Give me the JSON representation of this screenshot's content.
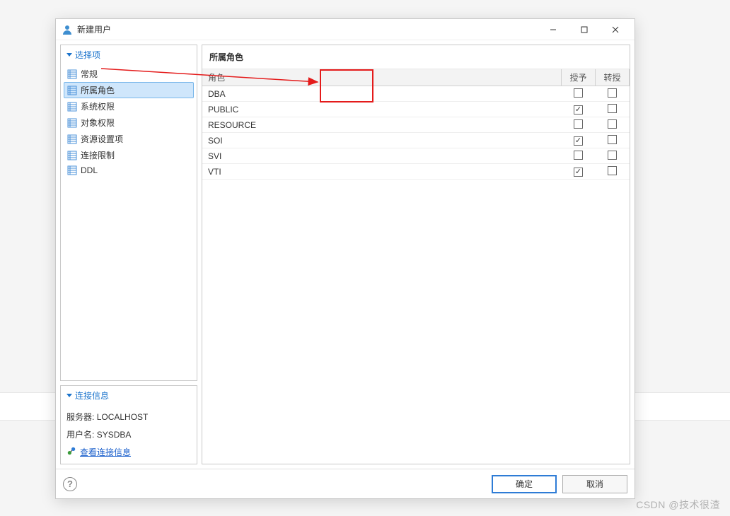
{
  "window": {
    "title": "新建用户"
  },
  "sidebar": {
    "select_header": "选择项",
    "items": [
      {
        "label": "常规"
      },
      {
        "label": "所属角色"
      },
      {
        "label": "系统权限"
      },
      {
        "label": "对象权限"
      },
      {
        "label": "资源设置项"
      },
      {
        "label": "连接限制"
      },
      {
        "label": "DDL"
      }
    ],
    "selected_index": 1,
    "connection_header": "连接信息",
    "server_label": "服务器:",
    "server_value": "LOCALHOST",
    "user_label": "用户名:",
    "user_value": "SYSDBA",
    "view_connection_link": "查看连接信息"
  },
  "content": {
    "title": "所属角色",
    "columns": {
      "role": "角色",
      "grant": "授予",
      "regrant": "转授"
    },
    "rows": [
      {
        "role": "DBA",
        "grant": false,
        "regrant": false
      },
      {
        "role": "PUBLIC",
        "grant": true,
        "regrant": false
      },
      {
        "role": "RESOURCE",
        "grant": false,
        "regrant": false
      },
      {
        "role": "SOI",
        "grant": true,
        "regrant": false
      },
      {
        "role": "SVI",
        "grant": false,
        "regrant": false
      },
      {
        "role": "VTI",
        "grant": true,
        "regrant": false
      }
    ]
  },
  "footer": {
    "ok": "确定",
    "cancel": "取消"
  },
  "watermark": "CSDN @技术很渣"
}
